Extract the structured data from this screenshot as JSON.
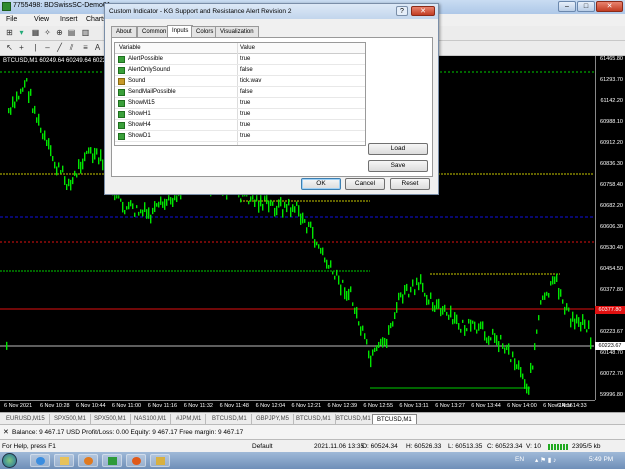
{
  "window": {
    "title": "7755498: BDSwissSC-Demo01 - ...",
    "minimize": "–",
    "maximize": "□",
    "close": "✕"
  },
  "menu": [
    "File",
    "View",
    "Insert",
    "Charts"
  ],
  "dialog": {
    "title": "Custom Indicator - KG Support and Resistance Alert Revision 2",
    "help": "?",
    "close": "✕",
    "tabs": [
      "About",
      "Common",
      "Inputs",
      "Colors",
      "Visualization"
    ],
    "active_tab": "Inputs",
    "columns": [
      "Variable",
      "Value"
    ],
    "rows": [
      {
        "name": "AlertPossible",
        "value": "true",
        "icon": "bool-icon"
      },
      {
        "name": "AlertOnlySound",
        "value": "false",
        "icon": "bool-icon"
      },
      {
        "name": "Sound",
        "value": "tick.wav",
        "icon": "string-icon"
      },
      {
        "name": "SendMailPossible",
        "value": "false",
        "icon": "bool-icon"
      },
      {
        "name": "ShowM15",
        "value": "true",
        "icon": "bool-icon"
      },
      {
        "name": "ShowH1",
        "value": "true",
        "icon": "bool-icon"
      },
      {
        "name": "ShowH4",
        "value": "true",
        "icon": "bool-icon"
      },
      {
        "name": "ShowD1",
        "value": "true",
        "icon": "bool-icon"
      }
    ],
    "load": "Load",
    "save": "Save",
    "ok": "OK",
    "cancel": "Cancel",
    "reset": "Reset"
  },
  "chart": {
    "label": "BTCUSD,M1  60249.64 60249.64 60227.1...",
    "price_ticks": [
      "61465.80",
      "61293.70",
      "61142.20",
      "60988.10",
      "60912.20",
      "60836.30",
      "60758.40",
      "60682.20",
      "60606.30",
      "60530.40",
      "60454.50",
      "60377.80",
      "60300.90",
      "60223.67",
      "60148.70",
      "60072.70",
      "59996.80"
    ],
    "price_tag_red": "60377.80",
    "price_tag_current": "60223.67",
    "time_ticks": [
      "6 Nov 2021",
      "6 Nov 10:28",
      "6 Nov 10:44",
      "6 Nov 11:00",
      "6 Nov 11:16",
      "6 Nov 11:32",
      "6 Nov 11:48",
      "6 Nov 12:04",
      "6 Nov 12:21",
      "6 Nov 12:39",
      "6 Nov 12:55",
      "6 Nov 13:11",
      "6 Nov 13:27",
      "6 Nov 13:44",
      "6 Nov 14:00",
      "6 Nov 14:16",
      "6 Nov 14:33"
    ],
    "colors": {
      "candles": "#00e600",
      "yellow": "#c8c800",
      "green": "#00cc00",
      "blue": "#1010e0",
      "red": "#e01010",
      "white": "#bbbbbb"
    }
  },
  "chart_tabs": [
    "EURUSD,M15",
    "SPX500,M1",
    "SPX500,M1",
    "NAS100,M1",
    "#JPM,M1",
    "BTCUSD,M1",
    "GBPJPY,M5",
    "BTCUSD,M1",
    "BTCUSD,M1",
    "BTCUSD,M1"
  ],
  "active_chart_tab": 9,
  "terminal": {
    "close": "✕",
    "balance_text": "Balance: 9 467.17 USD  Profit/Loss: 0.00  Equity: 9 467.17  Free margin: 9 467.17"
  },
  "status": {
    "help": "For Help, press F1",
    "profile": "Default",
    "datetime": "2021.11.06 13:35",
    "open": "O: 60524.34",
    "high": "H: 60526.33",
    "low": "L: 60513.35",
    "close": "C: 60523.34",
    "volume": "V: 10",
    "traffic": "2395/5 kb"
  },
  "taskbar": {
    "lang": "EN",
    "time": "5:49 PM",
    "icons": [
      "ie-icon",
      "folder-icon",
      "media-player-icon",
      "mt4-icon",
      "firefox-icon",
      "explorer-icon"
    ]
  }
}
